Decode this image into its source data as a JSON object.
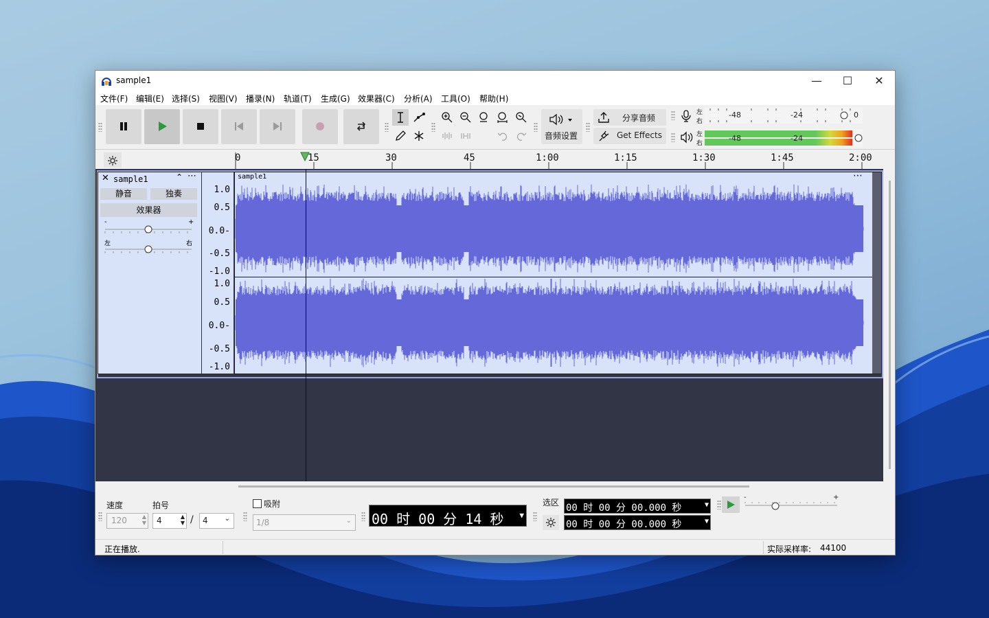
{
  "window": {
    "title": "sample1"
  },
  "menu": [
    "文件(F)",
    "编辑(E)",
    "选择(S)",
    "视图(V)",
    "播录(N)",
    "轨道(T)",
    "生成(G)",
    "效果器(C)",
    "分析(A)",
    "工具(O)",
    "帮助(H)"
  ],
  "toolbar": {
    "audio_setup_label": "音频设置",
    "share_label": "分享音频",
    "get_effects_label": "Get Effects",
    "meter_left": "左",
    "meter_right": "右",
    "meter_ticks": [
      "-48",
      "-24",
      "0"
    ],
    "record_meter_ticks": [
      "-48",
      "-24"
    ],
    "playback_meter_level": 0.97
  },
  "ruler": {
    "labels": [
      "0",
      "15",
      "30",
      "45",
      "1:00",
      "1:15",
      "1:30",
      "1:45",
      "2:00"
    ]
  },
  "track": {
    "name": "sample1",
    "clip_name": "sample1",
    "mute": "静音",
    "solo": "独奏",
    "effects": "效果器",
    "gain_minus": "-",
    "gain_plus": "+",
    "pan_left": "左",
    "pan_right": "右",
    "scale": [
      "1.0",
      "0.5",
      "0.0-",
      "-0.5",
      "-1.0"
    ]
  },
  "bottom": {
    "tempo_label": "速度",
    "tempo_value": "120",
    "timesig_label": "拍号",
    "timesig_upper": "4",
    "timesig_slash": "/",
    "timesig_lower": "4",
    "snap_label": "吸附",
    "snap_value": "1/8",
    "time_display": "00 时 00 分 14 秒",
    "selection_label": "选区",
    "sel_start": "00 时 00 分 00.000 秒",
    "sel_end": "00 时 00 分 00.000 秒",
    "speed_minus": "-",
    "speed_plus": "+"
  },
  "status": {
    "left": "正在播放.",
    "rate_label": "实际采样率:",
    "rate_value": "44100"
  }
}
